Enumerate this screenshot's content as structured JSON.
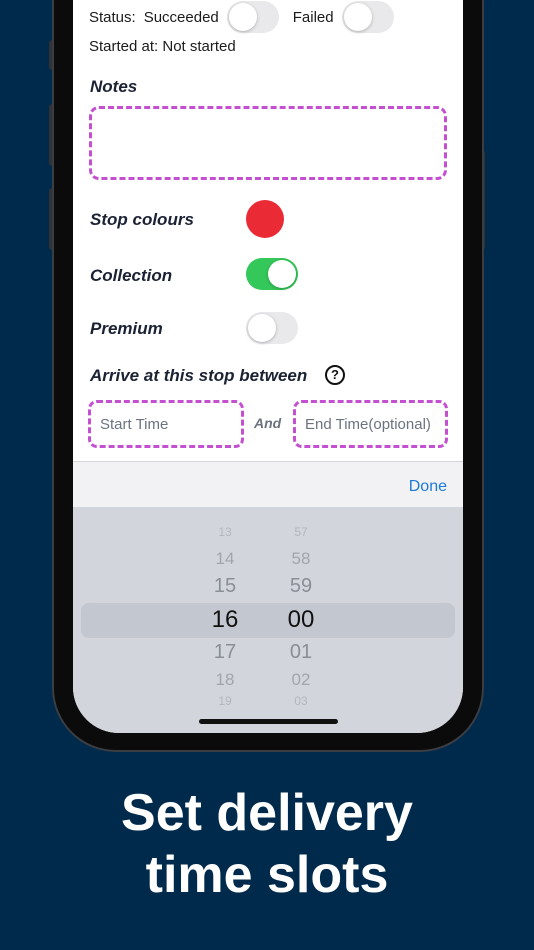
{
  "status_row": {
    "status_label": "Status:",
    "succeeded_label": "Succeeded",
    "failed_label": "Failed",
    "succeeded_on": false,
    "failed_on": false
  },
  "started_at": "Started at: Not started",
  "notes": {
    "label": "Notes",
    "value": ""
  },
  "stop_colours": {
    "label": "Stop colours",
    "color": "#ea2a35"
  },
  "collection": {
    "label": "Collection",
    "on": true
  },
  "premium": {
    "label": "Premium",
    "on": false
  },
  "arrive": {
    "label": "Arrive at this stop between",
    "help_icon": "question-circle-icon"
  },
  "start_time": {
    "placeholder": "Start Time"
  },
  "and_label": "And",
  "end_time": {
    "placeholder": "End Time(optional)"
  },
  "toolbar": {
    "done_label": "Done"
  },
  "picker": {
    "hours": [
      "13",
      "14",
      "15",
      "16",
      "17",
      "18",
      "19"
    ],
    "minutes": [
      "57",
      "58",
      "59",
      "00",
      "01",
      "02",
      "03"
    ],
    "selected_hour": "16",
    "selected_minute": "00"
  },
  "caption": {
    "line1": "Set delivery",
    "line2": "time slots"
  }
}
